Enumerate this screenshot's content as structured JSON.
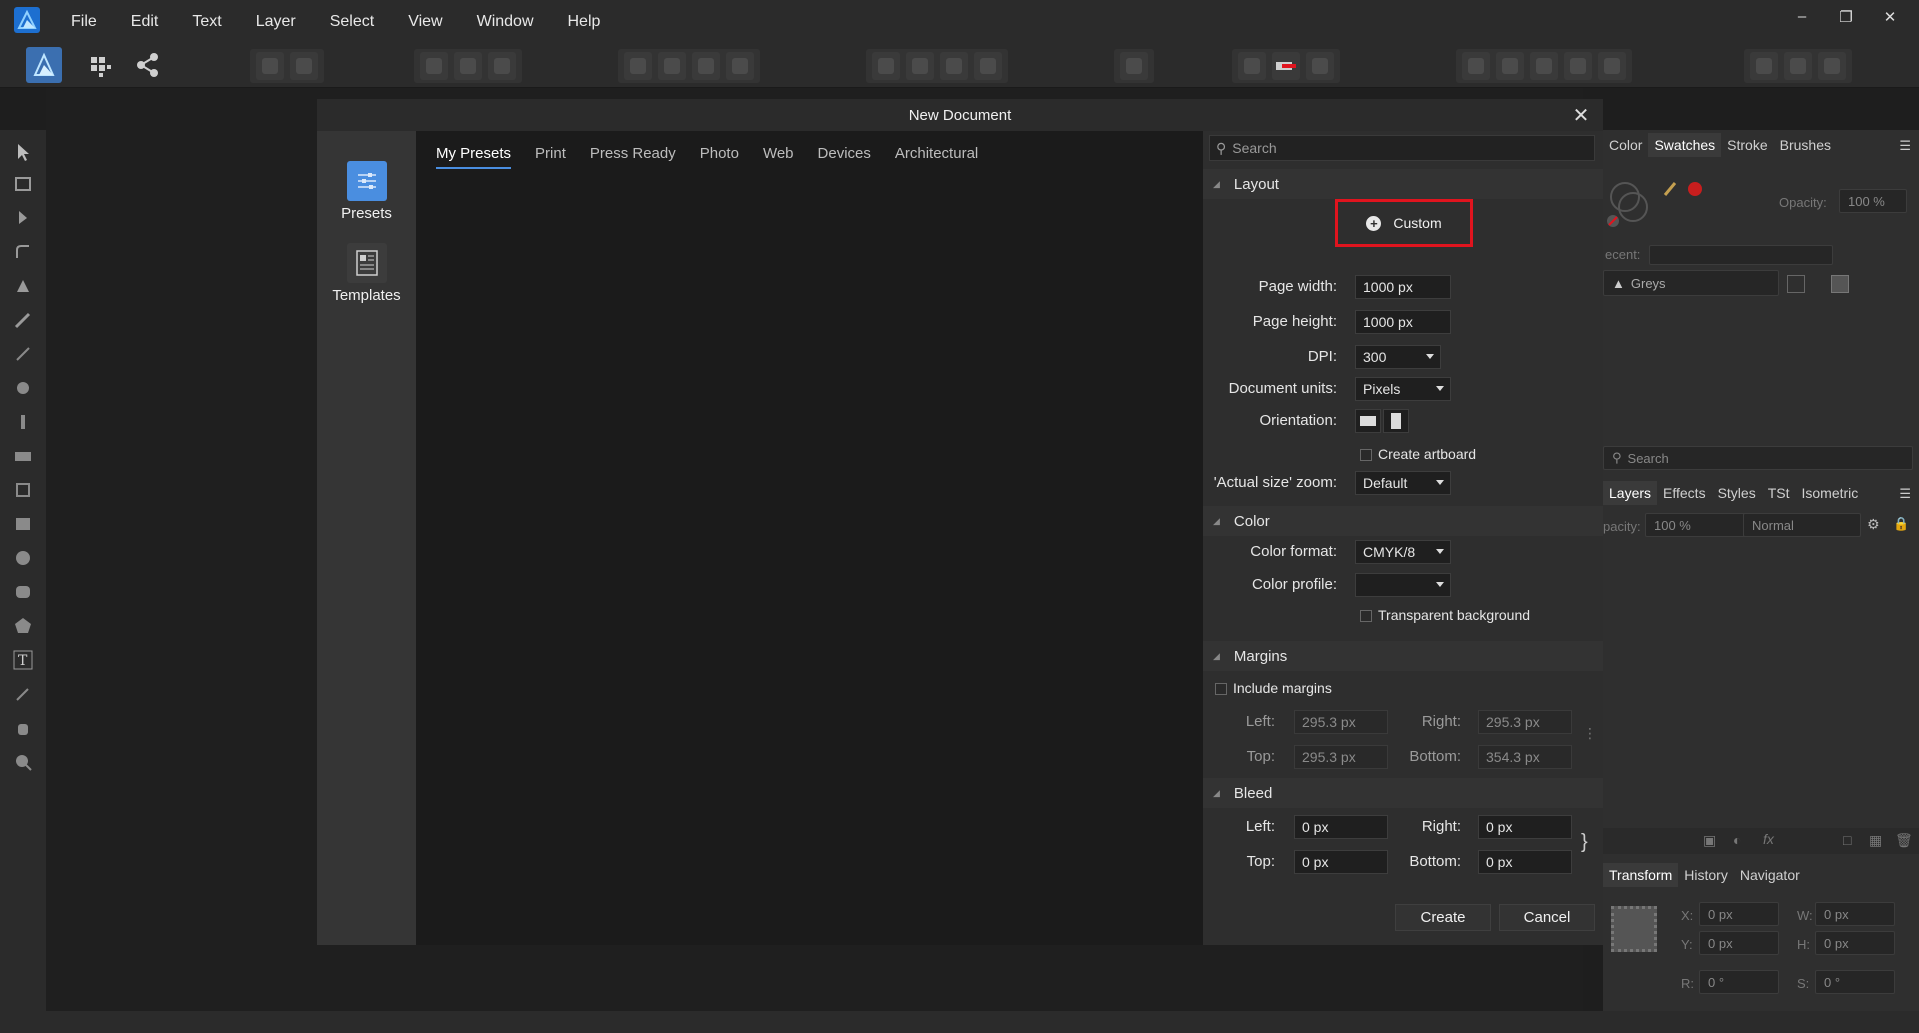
{
  "menubar": {
    "items": [
      "File",
      "Edit",
      "Text",
      "Layer",
      "Select",
      "View",
      "Window",
      "Help"
    ],
    "window_controls": {
      "minimize": "–",
      "restore": "❐",
      "close": "✕"
    }
  },
  "dialog": {
    "title": "New Document",
    "close": "✕",
    "sidebar": [
      {
        "label": "Presets",
        "icon": "presets-icon"
      },
      {
        "label": "Templates",
        "icon": "templates-icon"
      }
    ],
    "tabs": [
      "My Presets",
      "Print",
      "Press Ready",
      "Photo",
      "Web",
      "Devices",
      "Architectural"
    ],
    "active_tab": "My Presets",
    "search_placeholder": "Search",
    "layout": {
      "heading": "Layout",
      "custom_label": "Custom",
      "page_width_label": "Page width:",
      "page_width": "1000 px",
      "page_height_label": "Page height:",
      "page_height": "1000 px",
      "dpi_label": "DPI:",
      "dpi": "300",
      "units_label": "Document units:",
      "units": "Pixels",
      "orientation_label": "Orientation:",
      "artboard_label": "Create artboard",
      "zoom_label": "'Actual size' zoom:",
      "zoom": "Default"
    },
    "color": {
      "heading": "Color",
      "format_label": "Color format:",
      "format": "CMYK/8",
      "profile_label": "Color profile:",
      "profile": "",
      "transparent_label": "Transparent background"
    },
    "margins": {
      "heading": "Margins",
      "include_label": "Include margins",
      "left_label": "Left:",
      "left": "295.3 px",
      "right_label": "Right:",
      "right": "295.3 px",
      "top_label": "Top:",
      "top": "295.3 px",
      "bottom_label": "Bottom:",
      "bottom": "354.3 px"
    },
    "bleed": {
      "heading": "Bleed",
      "left_label": "Left:",
      "left": "0 px",
      "right_label": "Right:",
      "right": "0 px",
      "top_label": "Top:",
      "top": "0 px",
      "bottom_label": "Bottom:",
      "bottom": "0 px"
    },
    "create_label": "Create",
    "cancel_label": "Cancel"
  },
  "studio": {
    "top_tabs": [
      "Color",
      "Swatches",
      "Stroke",
      "Brushes"
    ],
    "top_active": "Swatches",
    "opacity_label": "Opacity:",
    "opacity": "100 %",
    "recent_label": "ecent:",
    "palette": "Greys",
    "search_placeholder": "Search",
    "layer_tabs": [
      "Layers",
      "Effects",
      "Styles",
      "TSt",
      "Isometric"
    ],
    "layer_active": "Layers",
    "layer_opacity_label": "pacity:",
    "layer_opacity": "100 %",
    "blend_mode": "Normal",
    "transform_tabs": [
      "Transform",
      "History",
      "Navigator"
    ],
    "transform_active": "Transform",
    "x_label": "X:",
    "x": "0 px",
    "y_label": "Y:",
    "y": "0 px",
    "w_label": "W:",
    "w": "0 px",
    "h_label": "H:",
    "h": "0 px",
    "r_label": "R:",
    "r": "0 °",
    "s_label": "S:",
    "s": "0 °"
  },
  "colors": {
    "accent": "#4a8ee0",
    "highlight_box": "#e0141e",
    "app_bg": "#1e1e1e",
    "panel_bg": "#2b2b2b"
  }
}
